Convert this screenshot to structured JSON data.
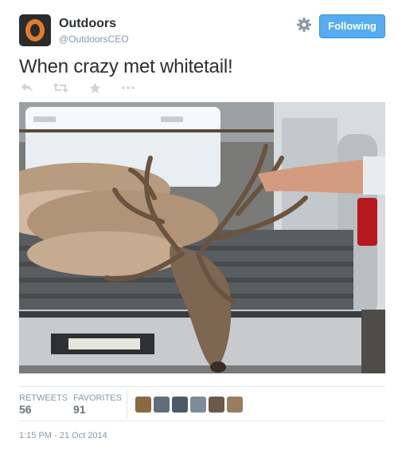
{
  "profile": {
    "name": "Outdoors",
    "handle": "@OutdoorsCEO"
  },
  "follow_button_label": "Following",
  "tweet": {
    "text": "When crazy met whitetail!"
  },
  "stats": {
    "retweets_label": "RETWEETS",
    "retweets_count": "56",
    "favorites_label": "FAVORITES",
    "favorites_count": "91"
  },
  "timestamp": "1:15 PM - 21 Oct 2014",
  "icons": [
    "gear-icon",
    "reply-icon",
    "retweet-icon",
    "favorite-icon",
    "more-icon"
  ],
  "colors": {
    "follow_button": "#55acee",
    "muted_text": "#8899a6",
    "primary_text": "#292f33"
  }
}
